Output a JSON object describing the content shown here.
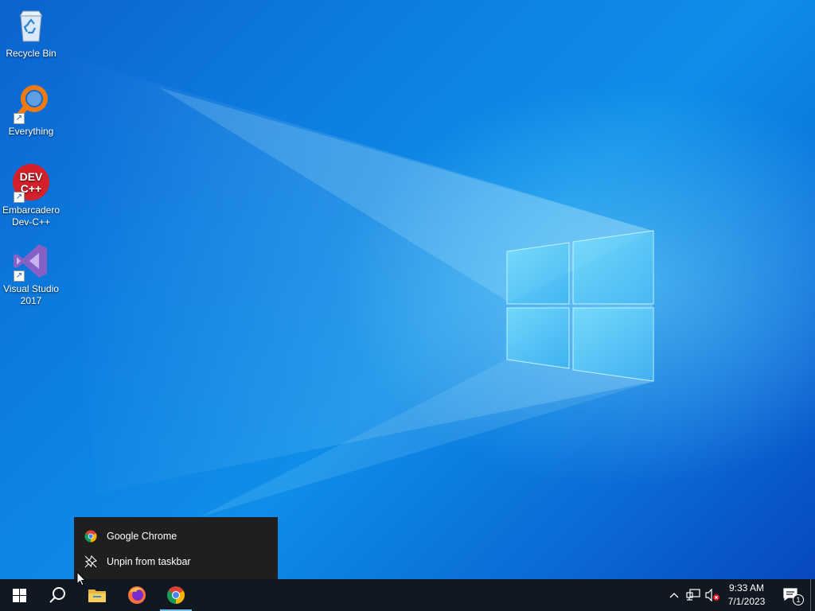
{
  "desktop": {
    "icons": [
      {
        "label": "Recycle Bin",
        "icon": "recycle-bin-icon"
      },
      {
        "label": "Everything",
        "icon": "everything-search-icon",
        "shortcut": true
      },
      {
        "label": "Embarcadero Dev-C++",
        "icon": "devcpp-icon",
        "shortcut": true,
        "badge_text": "DEV C++"
      },
      {
        "label": "Visual Studio 2017",
        "icon": "visual-studio-icon",
        "shortcut": true
      }
    ]
  },
  "context_menu": {
    "items": [
      {
        "label": "Google Chrome",
        "icon": "chrome-icon"
      },
      {
        "label": "Unpin from taskbar",
        "icon": "unpin-icon"
      }
    ]
  },
  "taskbar": {
    "apps": [
      "start-button",
      "search-button",
      "file-explorer",
      "firefox",
      "chrome"
    ],
    "tray": {
      "time": "9:33 AM",
      "date": "7/1/2023",
      "notifications_count": "1"
    }
  },
  "colors": {
    "taskbar_bg": "#101822",
    "menu_bg": "#1f1f1f",
    "accent": "#76b9ed"
  }
}
